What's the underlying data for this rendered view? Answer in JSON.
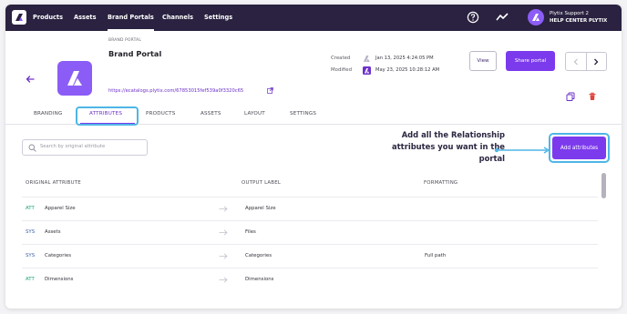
{
  "nav": {
    "items": [
      "Products",
      "Assets",
      "Brand Portals",
      "Channels",
      "Settings"
    ],
    "active_index": 2
  },
  "user": {
    "name": "Plytix Support 2",
    "org": "HELP CENTER PLYTIX"
  },
  "portal": {
    "kicker": "BRAND PORTAL",
    "title": "Brand Portal",
    "link": "https://ecatalogs.plytix.com/67853015fef539a0f3320c65"
  },
  "meta": {
    "created_label": "Created",
    "created_value": "Jan 13, 2025 4:24:05 PM",
    "modified_label": "Modified",
    "modified_value": "May 23, 2025 10:28:12 AM"
  },
  "buttons": {
    "view": "View",
    "share": "Share portal",
    "add": "Add attributes"
  },
  "tabs": [
    "BRANDING",
    "ATTRIBUTES",
    "PRODUCTS",
    "ASSETS",
    "LAYOUT",
    "SETTINGS"
  ],
  "active_tab": "ATTRIBUTES",
  "search": {
    "placeholder": "Search by original attribute"
  },
  "callout": {
    "line1": "Add all the Relationship",
    "line2": "attributes you want in the portal"
  },
  "table": {
    "headers": [
      "ORIGINAL ATTRIBUTE",
      "OUTPUT LABEL",
      "FORMATTING"
    ],
    "rows": [
      {
        "type": "ATT",
        "original": "Apparel Size",
        "output": "Apparel Size",
        "formatting": ""
      },
      {
        "type": "SYS",
        "original": "Assets",
        "output": "Files",
        "formatting": ""
      },
      {
        "type": "SYS",
        "original": "Categories",
        "output": "Categories",
        "formatting": "Full path"
      },
      {
        "type": "ATT",
        "original": "Dimensions",
        "output": "Dimensions",
        "formatting": ""
      }
    ]
  },
  "colors": {
    "topbar": "#2a2240",
    "accent": "#7c3aed",
    "highlight": "#4fb6e6",
    "att": "#19a57a",
    "sys": "#3a5fa8"
  }
}
